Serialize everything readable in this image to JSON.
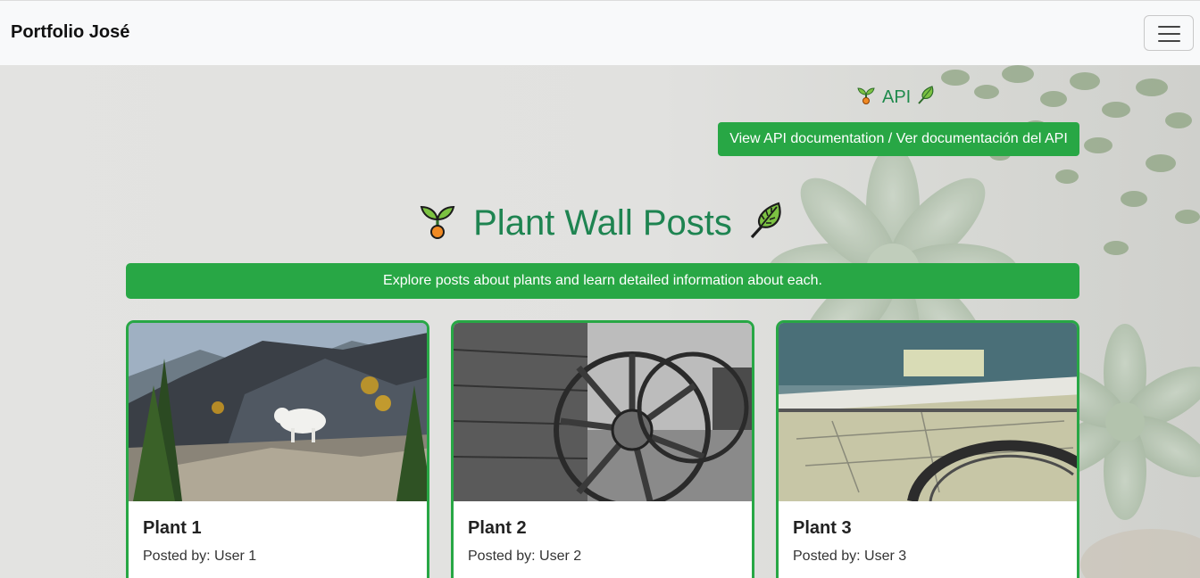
{
  "navbar": {
    "brand": "Portfolio José",
    "menu_icon": "hamburger-menu-icon"
  },
  "api": {
    "link_label": "API",
    "left_icon": "seedling-icon",
    "right_icon": "leaf-icon",
    "button_label": "View API documentation / Ver documentación del API"
  },
  "main": {
    "heading": "Plant Wall Posts",
    "heading_left_icon": "seedling-icon",
    "heading_right_icon": "leaf-icon",
    "banner": "Explore posts about plants and learn detailed information about each."
  },
  "posts": [
    {
      "title": "Plant 1",
      "posted_by": "Posted by: User 1",
      "image": "mountain-goat-photo"
    },
    {
      "title": "Plant 2",
      "posted_by": "Posted by: User 2",
      "image": "wagon-wheel-photo"
    },
    {
      "title": "Plant 3",
      "posted_by": "Posted by: User 3",
      "image": "blueprint-desk-photo"
    }
  ],
  "colors": {
    "accent_green": "#28a745",
    "heading_green": "#1e8451",
    "navbar_bg": "#f8f9fa"
  }
}
